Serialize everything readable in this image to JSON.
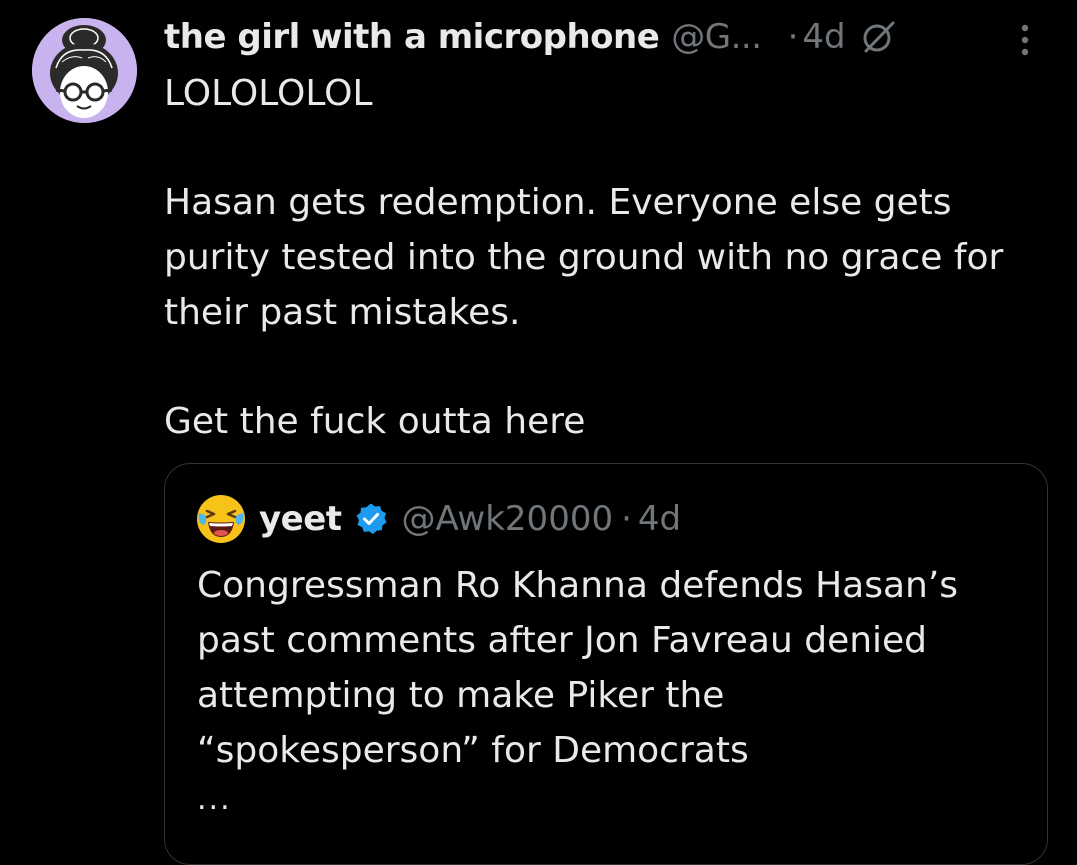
{
  "post": {
    "display_name": "the girl with a microphone",
    "handle": "@G...",
    "separator": "·",
    "time": "4d",
    "icons": {
      "avatar": "cartoon-woman-avatar",
      "grok": "grok-icon",
      "more": "more-vertical-icon"
    },
    "text_lines": [
      "LOLOLOLOL",
      "",
      "Hasan gets redemption. Everyone else gets",
      "purity tested into the ground with no grace for",
      "their past mistakes.",
      "",
      "Get the fuck outta here"
    ]
  },
  "quote": {
    "display_name": "yeet",
    "handle": "@Awk20000",
    "separator": "·",
    "time": "4d",
    "icons": {
      "avatar": "laughing-crying-emoji",
      "verified": "verified-badge-icon"
    },
    "text_lines": [
      "Congressman Ro Khanna defends Hasan’s",
      "past comments after Jon Favreau denied",
      "attempting to make Piker the",
      "“spokesperson” for Democrats"
    ],
    "ellipsis": "..."
  },
  "colors": {
    "background": "#000000",
    "primary_text": "#e7e9ea",
    "secondary_text": "#71767b",
    "border": "#2f3336",
    "verified_blue": "#1d9bf0",
    "avatar_bg": "#c9b3ee"
  }
}
